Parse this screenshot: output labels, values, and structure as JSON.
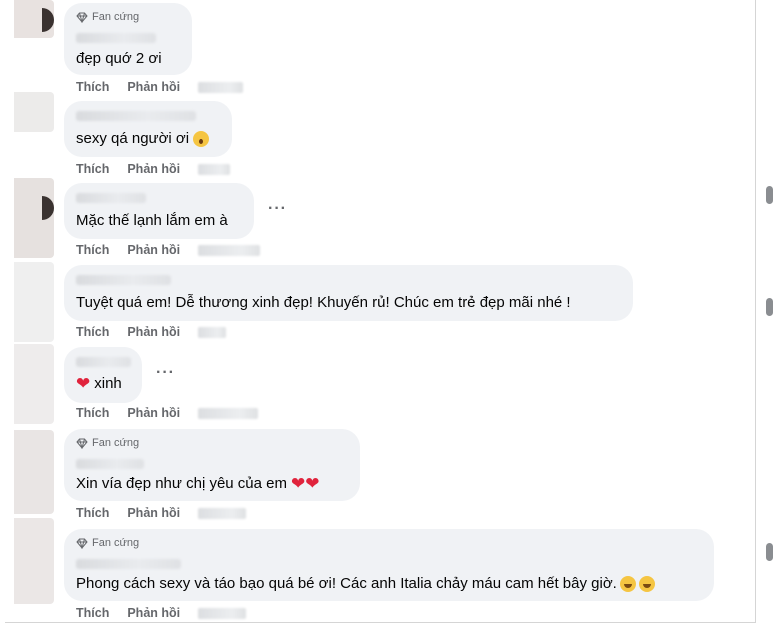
{
  "badge_label": "Fan cứng",
  "action_like": "Thích",
  "action_reply": "Phản hồi",
  "colors": {
    "bubble_bg": "#f0f2f5",
    "meta_text": "#65676b",
    "heart": "#e0233c"
  },
  "comments": [
    {
      "has_badge": true,
      "text": "đẹp quớ 2 ơi",
      "emoji": ""
    },
    {
      "has_badge": false,
      "text": "sexy qá người ơi",
      "emoji": "shocked-face-emoji"
    },
    {
      "has_badge": false,
      "text": "Mặc thế lạnh lắm em à",
      "emoji": ""
    },
    {
      "has_badge": false,
      "text": "Tuyệt quá em! Dễ thương xinh đẹp! Khuyến rủ! Chúc em trẻ đẹp mãi nhé !",
      "emoji": ""
    },
    {
      "has_badge": false,
      "text": "xinh",
      "emoji": "heart-emoji"
    },
    {
      "has_badge": true,
      "text": "Xin vía đẹp như chị yêu của em",
      "emoji": "heart-emoji x2"
    },
    {
      "has_badge": true,
      "text": "Phong cách sexy và táo bạo quá bé ơi! Các anh Italia chảy máu cam hết bây giờ.",
      "emoji": "grinning-face-emoji x2"
    }
  ]
}
